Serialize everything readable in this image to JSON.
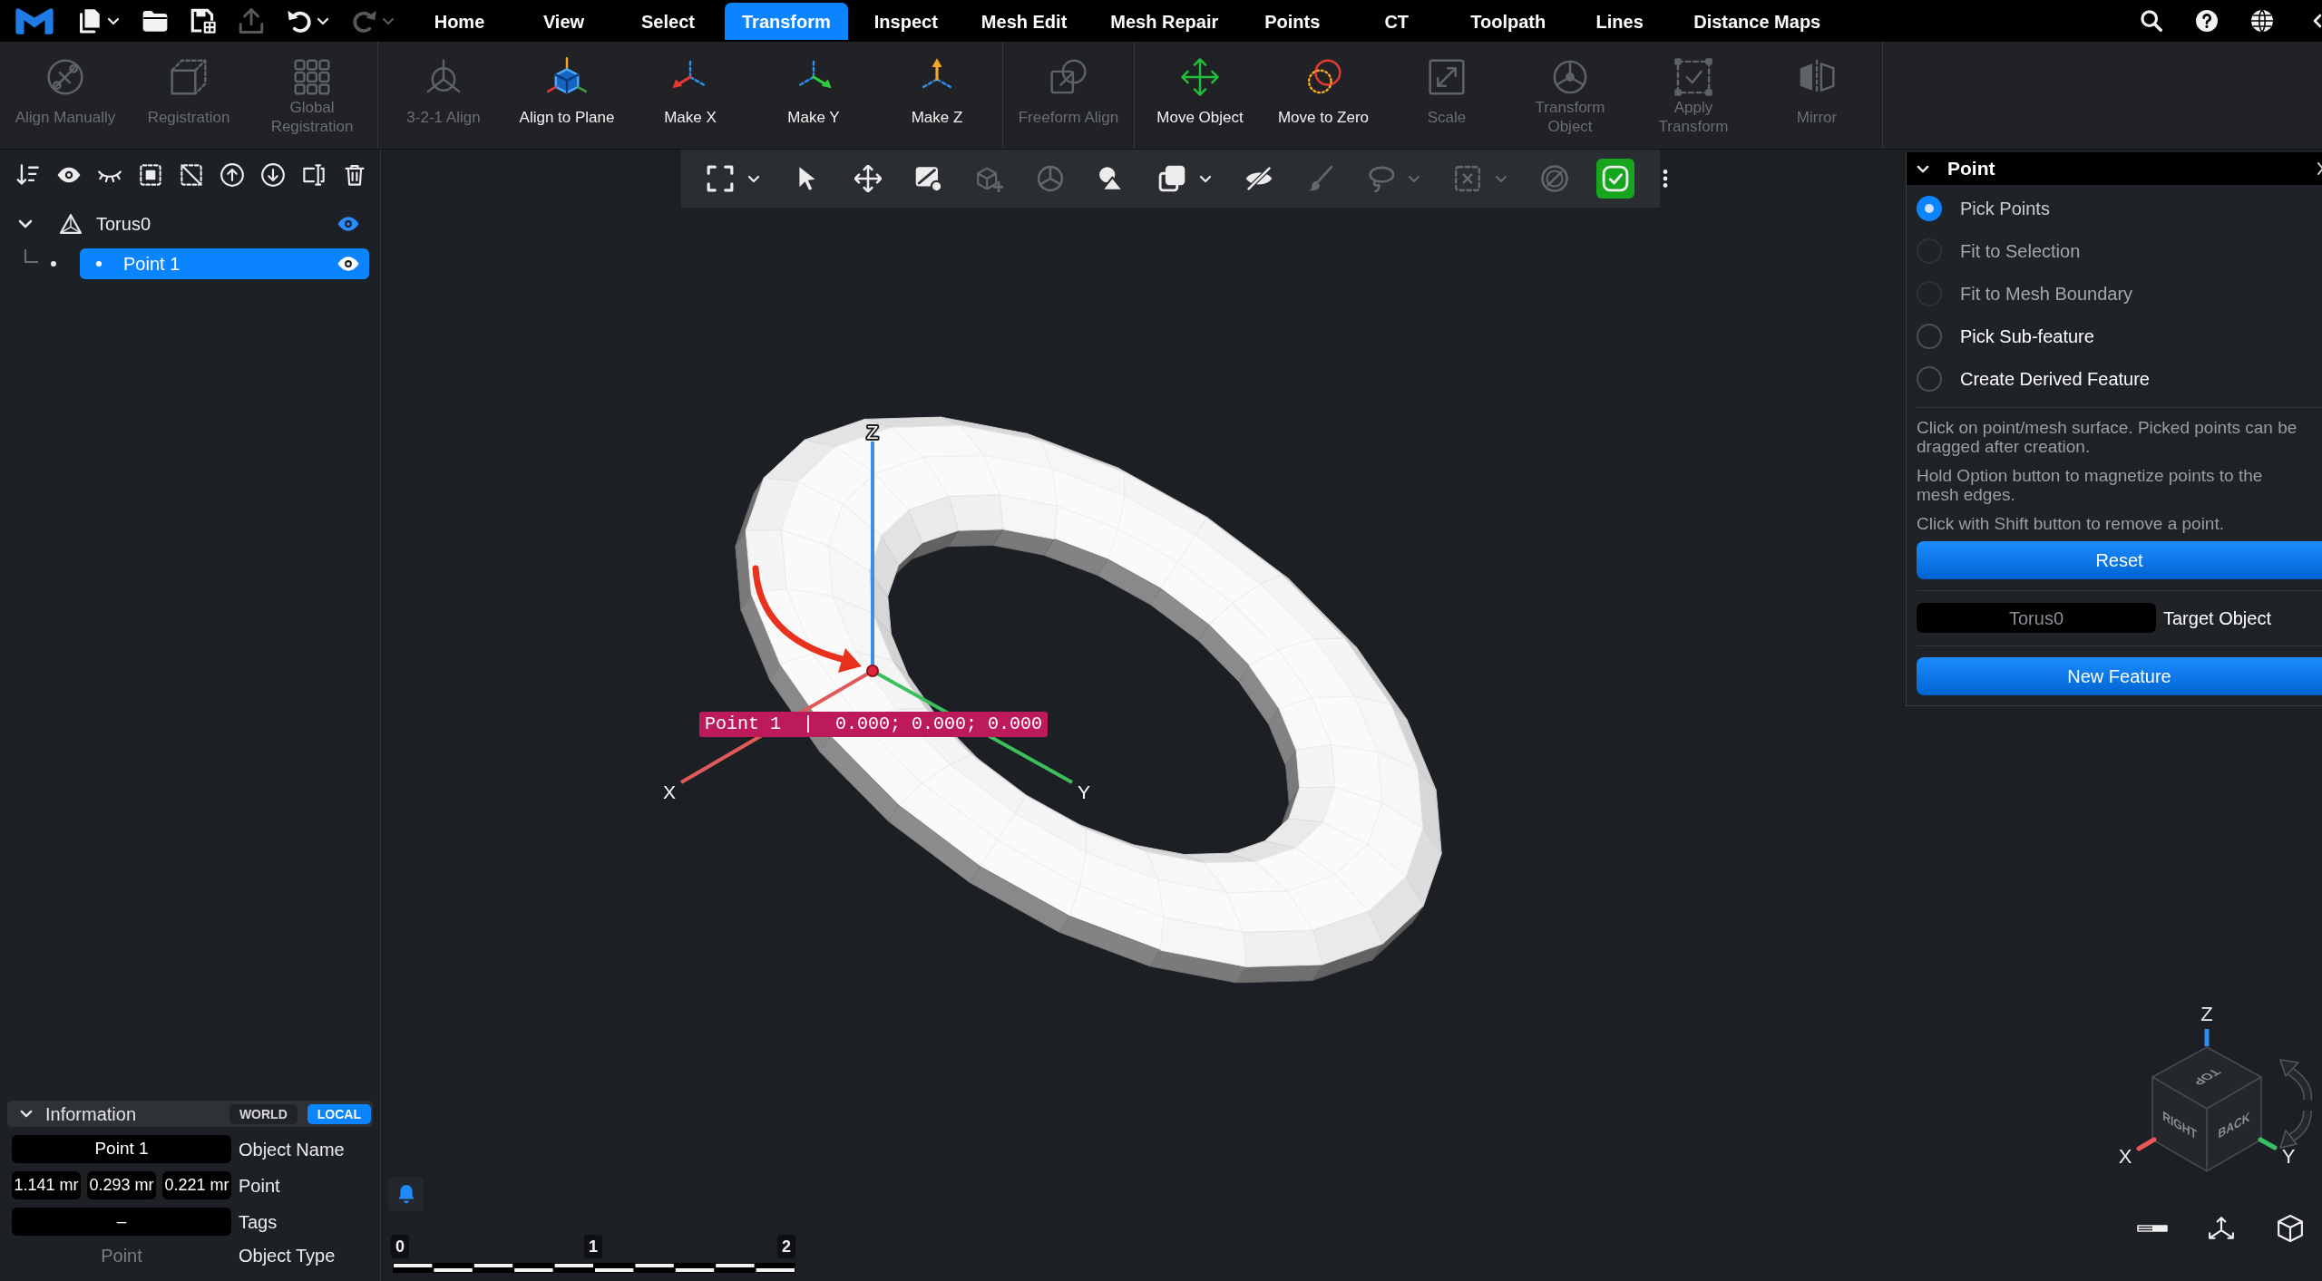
{
  "menu_bar": {
    "quick_access": [
      {
        "disabled": false
      },
      {
        "disabled": false
      },
      {
        "disabled": false
      },
      {
        "disabled": true
      },
      {
        "disabled": false
      },
      {
        "disabled": true
      }
    ],
    "tabs": [
      {
        "label": "Home",
        "selected": false
      },
      {
        "label": "View",
        "selected": false
      },
      {
        "label": "Select",
        "selected": false
      },
      {
        "label": "Transform",
        "selected": true
      },
      {
        "label": "Inspect",
        "selected": false
      },
      {
        "label": "Mesh Edit",
        "selected": false
      },
      {
        "label": "Mesh Repair",
        "selected": false
      },
      {
        "label": "Points",
        "selected": false
      },
      {
        "label": "CT",
        "selected": false
      },
      {
        "label": "Toolpath",
        "selected": false
      },
      {
        "label": "Lines",
        "selected": false
      },
      {
        "label": "Distance Maps",
        "selected": false
      }
    ]
  },
  "ribbon": {
    "groups": [
      {
        "items": [
          {
            "label": "Align Manually",
            "disabled": true
          },
          {
            "label": "Registration",
            "disabled": true
          },
          {
            "label": "Global Registration",
            "disabled": true
          }
        ]
      },
      {
        "items": [
          {
            "label": "3-2-1 Align",
            "disabled": true
          },
          {
            "label": "Align to Plane",
            "disabled": false
          },
          {
            "label": "Make X",
            "disabled": false
          },
          {
            "label": "Make Y",
            "disabled": false
          },
          {
            "label": "Make Z",
            "disabled": false
          }
        ]
      },
      {
        "items": [
          {
            "label": "Freeform Align",
            "disabled": true
          }
        ]
      },
      {
        "items": [
          {
            "label": "Move Object",
            "disabled": false
          },
          {
            "label": "Move to Zero",
            "disabled": false
          },
          {
            "label": "Scale",
            "disabled": true
          },
          {
            "label": "Transform Object",
            "disabled": true
          },
          {
            "label": "Apply Transform",
            "disabled": true
          },
          {
            "label": "Mirror",
            "disabled": true
          }
        ]
      }
    ]
  },
  "scene_tree": [
    {
      "label": "Torus0",
      "expanded": true,
      "visible": true,
      "selected": false,
      "children": [
        {
          "label": "Point 1",
          "visible": true,
          "selected": true
        }
      ]
    }
  ],
  "viewport": {
    "toolbar": [
      {
        "disabled": false,
        "on": false
      },
      {
        "disabled": false,
        "on": false
      },
      {
        "disabled": false,
        "on": false
      },
      {
        "disabled": false,
        "on": false
      },
      {
        "disabled": true,
        "on": false
      },
      {
        "disabled": true,
        "on": false
      },
      {
        "disabled": false,
        "on": false
      },
      {
        "disabled": false,
        "on": false
      },
      {
        "disabled": false,
        "on": false
      },
      {
        "disabled": true,
        "on": false
      },
      {
        "disabled": true,
        "on": false
      },
      {
        "disabled": true,
        "on": false
      },
      {
        "disabled": true,
        "on": false
      },
      {
        "disabled": false,
        "on": true
      },
      {
        "disabled": false,
        "on": false
      }
    ],
    "axis_labels": [
      "Z",
      "X",
      "Y"
    ],
    "point_label": "Point 1  |  0.000; 0.000; 0.000",
    "scale_bar": [
      "0",
      "1",
      "2"
    ],
    "view_cube": {
      "axis_labels": [
        "Z",
        "X",
        "Y"
      ],
      "faces": [
        "TOP",
        "RIGHT",
        "BACK"
      ]
    }
  },
  "point_panel": {
    "title": "Point",
    "expanded": true,
    "modes": [
      {
        "label": "Pick Points",
        "selected": true,
        "disabled": false
      },
      {
        "label": "Fit to Selection",
        "selected": false,
        "disabled": true
      },
      {
        "label": "Fit to Mesh Boundary",
        "selected": false,
        "disabled": true
      },
      {
        "label": "Pick Sub-feature",
        "selected": false,
        "disabled": false
      },
      {
        "label": "Create Derived Feature",
        "selected": false,
        "disabled": false
      }
    ],
    "hints": [
      "Click on point/mesh surface. Picked points can be dragged after creation.",
      "Hold Option button to magnetize points to the mesh edges.",
      "Click with Shift button to remove a point."
    ],
    "reset_button": "Reset",
    "target": {
      "value": "Torus0",
      "label": "Target Object"
    },
    "new_feature_button": "New Feature"
  },
  "information": {
    "title": "Information",
    "expanded": true,
    "frames": [
      {
        "label": "WORLD",
        "selected": false
      },
      {
        "label": "LOCAL",
        "selected": true
      }
    ],
    "fields": [
      {
        "kind": "input",
        "values": [
          "Point 1"
        ],
        "label": "Object Name"
      },
      {
        "kind": "input",
        "values": [
          "1.141 mr",
          "0.293 mr",
          "0.221 mr"
        ],
        "label": "Point"
      },
      {
        "kind": "input",
        "values": [
          "–"
        ],
        "label": "Tags"
      },
      {
        "kind": "readonly",
        "values": [
          "Point"
        ],
        "label": "Object Type"
      }
    ]
  }
}
